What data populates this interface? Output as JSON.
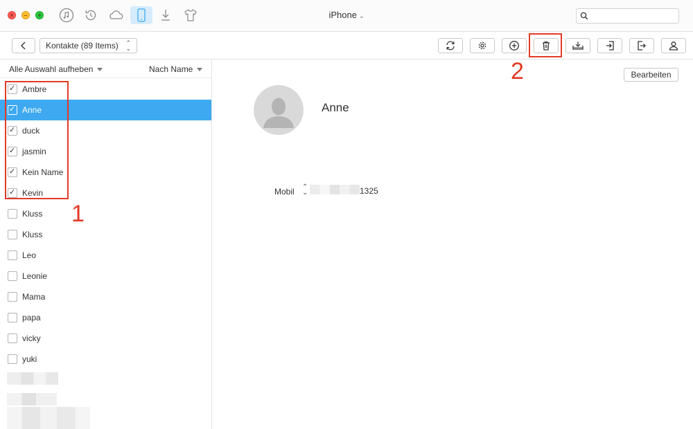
{
  "window": {
    "device_title": "iPhone"
  },
  "toolbar": {
    "category_label": "Kontakte (89 Items)"
  },
  "list_header": {
    "deselect_all": "Alle Auswahl aufheben",
    "sort_by": "Nach Name"
  },
  "contacts": [
    {
      "name": "Ambre",
      "checked": true
    },
    {
      "name": "Anne",
      "checked": true,
      "selected": true
    },
    {
      "name": "duck",
      "checked": true
    },
    {
      "name": "jasmin",
      "checked": true
    },
    {
      "name": "Kein Name",
      "checked": true
    },
    {
      "name": "Kevin",
      "checked": true
    },
    {
      "name": "Kluss",
      "checked": false
    },
    {
      "name": "Kluss",
      "checked": false
    },
    {
      "name": "Leo",
      "checked": false
    },
    {
      "name": "Leonie",
      "checked": false
    },
    {
      "name": "Mama",
      "checked": false
    },
    {
      "name": "papa",
      "checked": false
    },
    {
      "name": "vicky",
      "checked": false
    },
    {
      "name": "yuki",
      "checked": false
    }
  ],
  "detail": {
    "edit_label": "Bearbeiten",
    "contact_name": "Anne",
    "phone_label": "Mobil",
    "phone_value_visible": "1325"
  },
  "annotations": {
    "step1": "1",
    "step2": "2"
  },
  "colors": {
    "accent": "#3ea9f0",
    "annotation": "#e33a26"
  },
  "icons": [
    "music-icon",
    "history-icon",
    "cloud-icon",
    "phone-icon",
    "download-icon",
    "tshirt-icon",
    "search-icon",
    "refresh-icon",
    "gear-icon",
    "add-icon",
    "trash-icon",
    "export-to-computer-icon",
    "import-icon",
    "export-icon",
    "contact-icon"
  ]
}
